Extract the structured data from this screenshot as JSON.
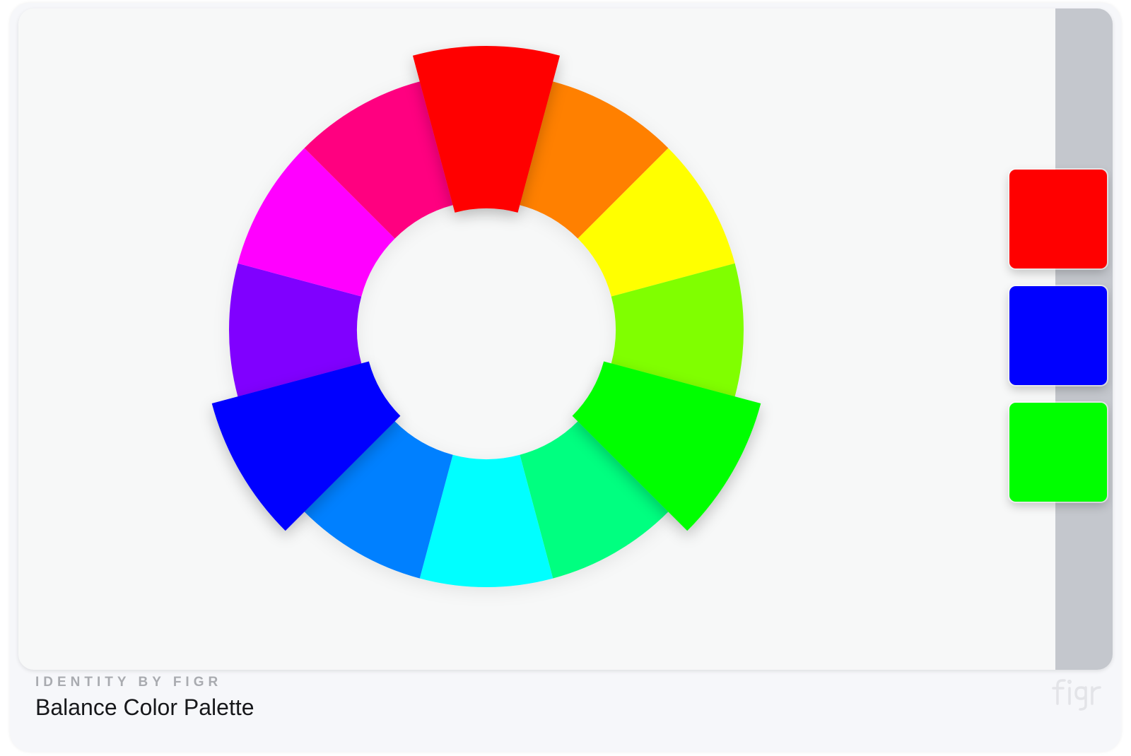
{
  "card": {
    "eyebrow": "IDENTITY BY FIGR",
    "title": "Balance Color Palette",
    "logo_icon": "figr-logo-icon"
  },
  "wheel": {
    "segments": [
      {
        "name": "red",
        "color": "#ff0000",
        "highlighted": true
      },
      {
        "name": "orange",
        "color": "#ff8000",
        "highlighted": false
      },
      {
        "name": "yellow",
        "color": "#ffff00",
        "highlighted": false
      },
      {
        "name": "chartreuse",
        "color": "#80ff00",
        "highlighted": false
      },
      {
        "name": "green",
        "color": "#00ff00",
        "highlighted": true
      },
      {
        "name": "spring-green",
        "color": "#00ff80",
        "highlighted": false
      },
      {
        "name": "cyan",
        "color": "#00ffff",
        "highlighted": false
      },
      {
        "name": "azure",
        "color": "#0080ff",
        "highlighted": false
      },
      {
        "name": "blue",
        "color": "#0000ff",
        "highlighted": true
      },
      {
        "name": "violet",
        "color": "#8000ff",
        "highlighted": false
      },
      {
        "name": "magenta",
        "color": "#ff00ff",
        "highlighted": false
      },
      {
        "name": "rose",
        "color": "#ff0080",
        "highlighted": false
      }
    ]
  },
  "palette": [
    {
      "name": "red",
      "color": "#ff0000"
    },
    {
      "name": "blue",
      "color": "#0000ff"
    },
    {
      "name": "green",
      "color": "#00ff00"
    }
  ],
  "colors": {
    "card_background": "#f6f7fa",
    "panel_background": "#f7f8f8",
    "side_strip": "#c4c7cd"
  }
}
